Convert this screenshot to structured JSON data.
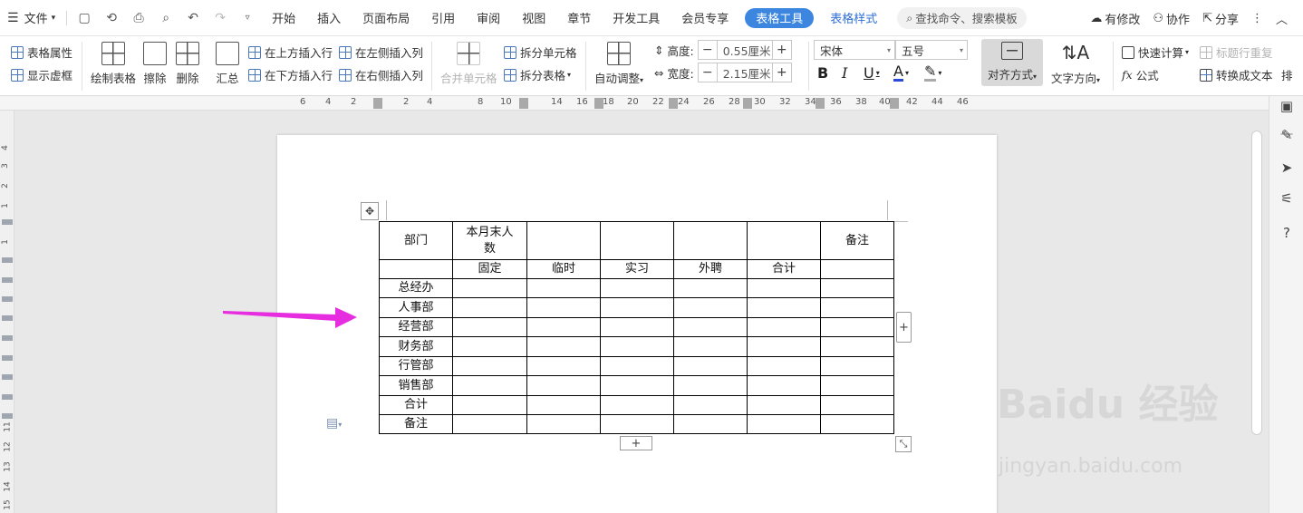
{
  "menubar": {
    "file_label": "文件",
    "tabs": [
      "开始",
      "插入",
      "页面布局",
      "引用",
      "审阅",
      "视图",
      "章节",
      "开发工具",
      "会员专享"
    ],
    "active_tab": "表格工具",
    "extra_tab": "表格样式",
    "search_placeholder": "查找命令、搜索模板",
    "right": {
      "modified": "有修改",
      "collab": "协作",
      "share": "分享"
    }
  },
  "ribbon": {
    "table_props": "表格属性",
    "show_gridlines": "显示虚框",
    "draw_table": "绘制表格",
    "erase": "擦除",
    "delete": "删除",
    "summary": "汇总",
    "insert_above": "在上方插入行",
    "insert_below": "在下方插入行",
    "insert_left": "在左侧插入列",
    "insert_right": "在右侧插入列",
    "merge_cells": "合并单元格",
    "split_cells": "拆分单元格",
    "split_table": "拆分表格",
    "auto_adjust": "自动调整",
    "height_label": "高度:",
    "height_value": "0.55厘米",
    "width_label": "宽度:",
    "width_value": "2.15厘米",
    "font_name": "宋体",
    "font_size": "五号",
    "align": "对齐方式",
    "text_direction": "文字方向",
    "quick_calc": "快速计算",
    "title_repeat": "标题行重复",
    "formula": "公式",
    "convert_text": "转换成文本",
    "more": "排"
  },
  "ruler": {
    "h_numbers": [
      "6",
      "4",
      "2",
      "2",
      "4",
      "8",
      "10",
      "14",
      "16",
      "18",
      "20",
      "22",
      "24",
      "26",
      "28",
      "30",
      "32",
      "34",
      "36",
      "38",
      "40",
      "42",
      "44",
      "46"
    ],
    "v_numbers": [
      "4",
      "3",
      "2",
      "1",
      "1",
      "2",
      "11",
      "12",
      "13",
      "14",
      "15"
    ]
  },
  "table": {
    "row1": [
      "部门",
      "本月末人数",
      "",
      "",
      "",
      "",
      "备注"
    ],
    "row2": [
      "",
      "固定",
      "临时",
      "实习",
      "外聘",
      "合计",
      ""
    ],
    "departments": [
      "总经办",
      "人事部",
      "经营部",
      "财务部",
      "行管部",
      "销售部",
      "合计",
      "备注"
    ]
  },
  "watermark": {
    "brand": "Baidu 经验",
    "url": "jingyan.baidu.com"
  },
  "colors": {
    "accent": "#3d86e0",
    "arrow": "#e62ee0"
  }
}
